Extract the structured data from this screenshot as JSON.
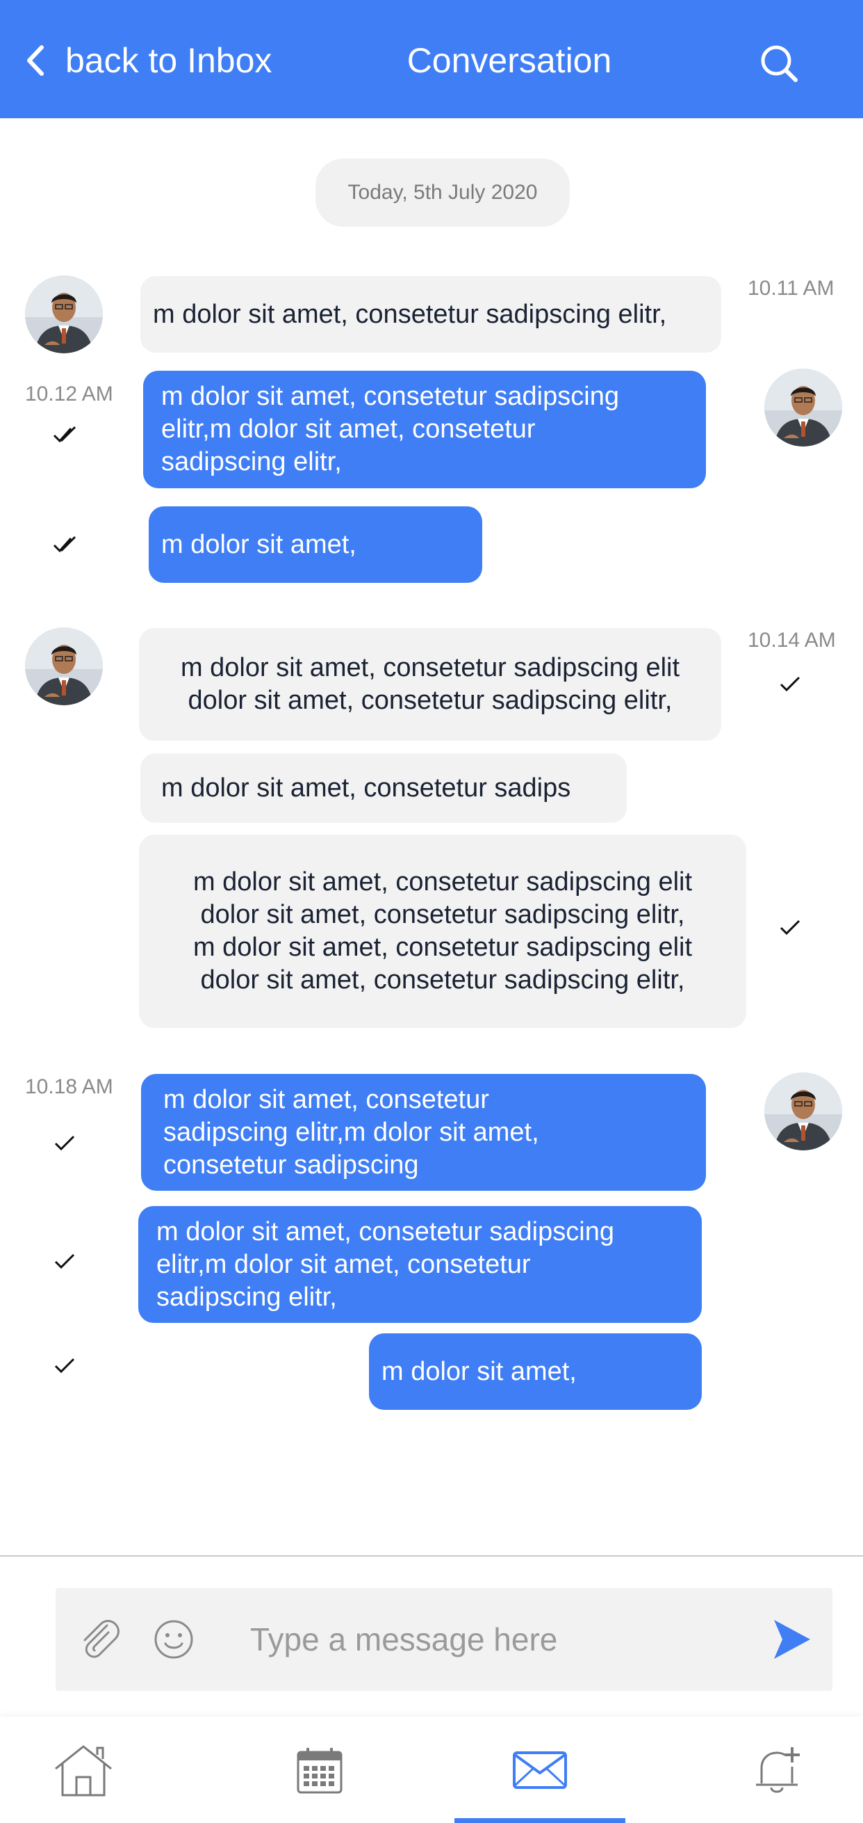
{
  "header": {
    "back_label": "back to Inbox",
    "title": "Conversation"
  },
  "date_chip": "Today, 5th July 2020",
  "messages": [
    {
      "time": "10.11 AM",
      "text": "m dolor sit amet, consetetur sadipscing elitr,"
    },
    {
      "time": "10.12 AM",
      "text": "m dolor sit amet, consetetur sadipscing\nelitr,m dolor sit amet, consetetur\nsadipscing elitr,"
    },
    {
      "text": "m dolor sit amet,"
    },
    {
      "time": "10.14 AM",
      "text": "m dolor sit amet, consetetur sadipscing elit\ndolor sit amet, consetetur sadipscing elitr,"
    },
    {
      "text": "m dolor sit amet, consetetur sadips"
    },
    {
      "text": "m dolor sit amet, consetetur sadipscing elit\ndolor sit amet, consetetur sadipscing elitr,\nm dolor sit amet, consetetur sadipscing elit\ndolor sit amet, consetetur sadipscing elitr,"
    },
    {
      "time": "10.18 AM",
      "text": "m dolor sit amet, consetetur\nsadipscing elitr,m dolor sit amet,\nconsetetur sadipscing"
    },
    {
      "text": "m dolor sit amet, consetetur sadipscing\nelitr,m dolor sit amet, consetetur\nsadipscing elitr,"
    },
    {
      "text": "m dolor sit amet,"
    }
  ],
  "composer": {
    "placeholder": "Type a message here"
  },
  "icons": {
    "back": "chevron-left-icon",
    "search": "search-icon",
    "attach": "paperclip-icon",
    "emoji": "smiley-icon",
    "send": "send-icon",
    "home": "home-icon",
    "calendar": "calendar-icon",
    "mail": "mail-icon",
    "bell": "bell-plus-icon"
  },
  "colors": {
    "primary": "#3f7ef5",
    "incoming_bubble": "#f2f2f2",
    "incoming_text": "#1a2233",
    "muted_text": "#8a8a8a"
  },
  "bottom_nav": {
    "active": "mail"
  }
}
